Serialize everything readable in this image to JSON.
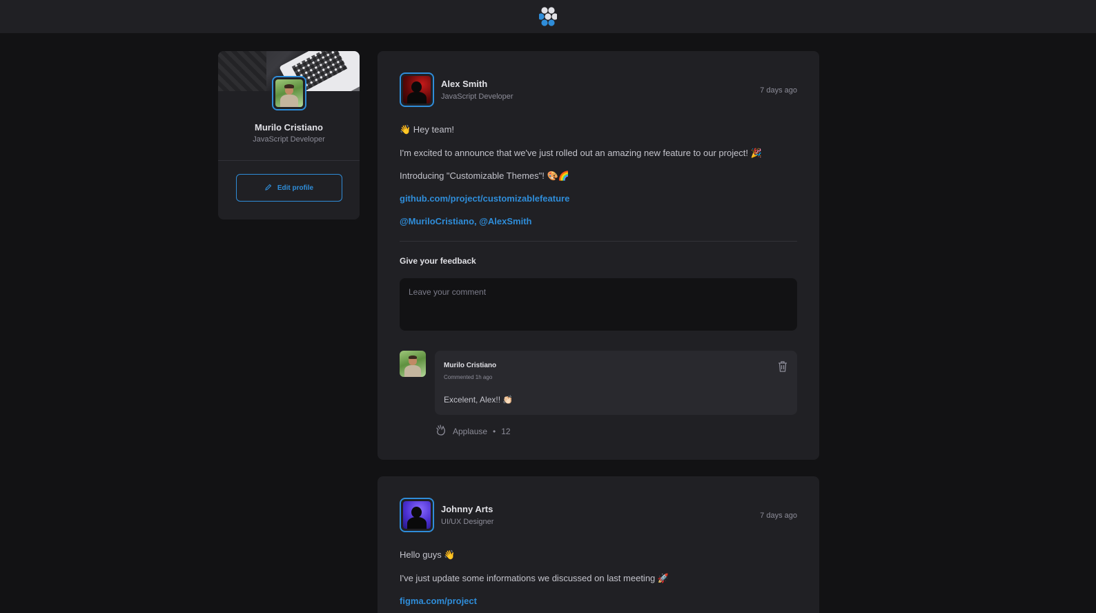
{
  "header": {
    "logo_icon": "hexagon-cluster-logo"
  },
  "profile": {
    "name": "Murilo Cristiano",
    "role": "JavaScript Developer",
    "edit_label": "Edit profile"
  },
  "posts": [
    {
      "author": "Alex Smith",
      "role": "JavaScript Developer",
      "time": "7 days ago",
      "lines": [
        "👋 Hey team!",
        "I'm excited to announce that we've just rolled out an amazing new feature to our project! 🎉",
        "Introducing \"Customizable Themes\"! 🎨🌈"
      ],
      "link": "github.com/project/customizablefeature",
      "mentions": "@MuriloCristiano, @AlexSmith",
      "feedback_title": "Give your feedback",
      "comment_placeholder": "Leave your comment",
      "comments": [
        {
          "author": "Murilo Cristiano",
          "time": "Commented 1h ago",
          "text": "Excelent, Alex!! 👏🏻",
          "applause_label": "Applause",
          "applause_separator": "•",
          "applause_count": "12"
        }
      ]
    },
    {
      "author": "Johnny Arts",
      "role": "UI/UX Designer",
      "time": "7 days ago",
      "lines": [
        "Hello guys 👋",
        "I've just update some informations we discussed on last meeting 🚀"
      ],
      "link": "figma.com/project"
    }
  ],
  "colors": {
    "background": "#121214",
    "surface": "#202024",
    "accent": "#2f8dd9",
    "text": "#c4c4cc",
    "muted": "#8d8d99"
  }
}
